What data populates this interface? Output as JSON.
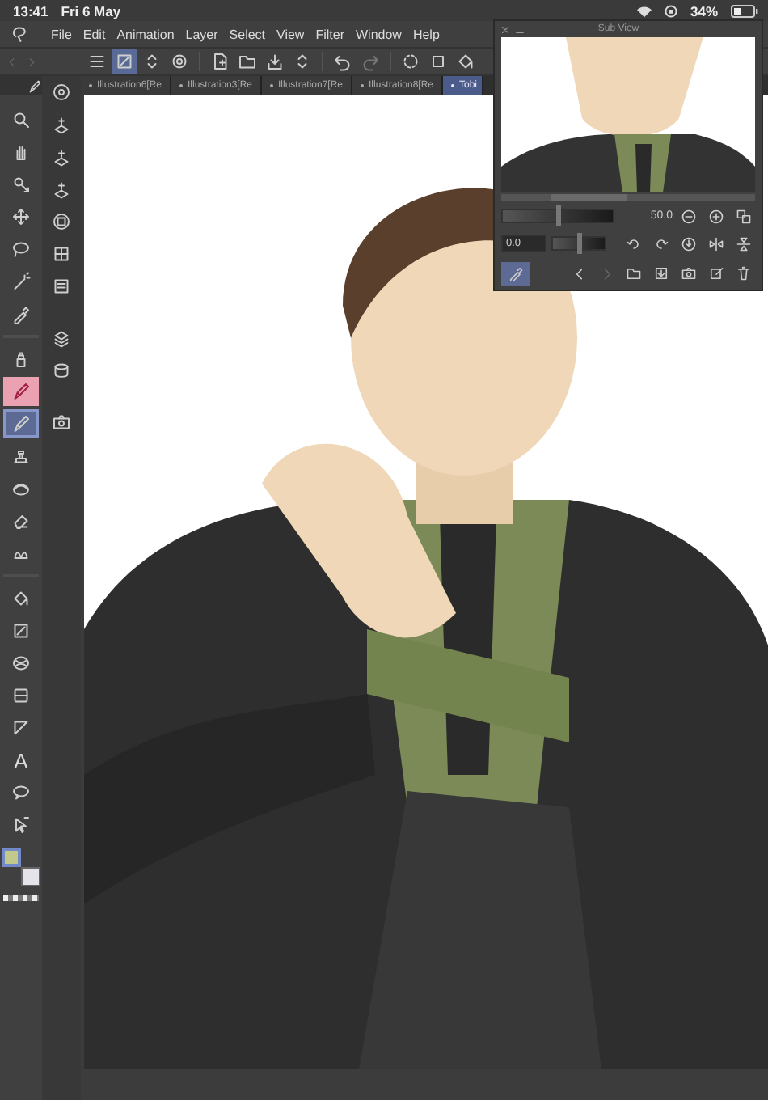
{
  "status_bar": {
    "time": "13:41",
    "date": "Fri 6 May",
    "battery": "34%"
  },
  "menu": [
    "File",
    "Edit",
    "Animation",
    "Layer",
    "Select",
    "View",
    "Filter",
    "Window",
    "Help"
  ],
  "toolbar": [
    {
      "selected": false
    },
    {
      "selected": true
    },
    {
      "selected": false
    },
    {
      "selected": false
    },
    {
      "selected": false
    },
    {
      "selected": false
    },
    {
      "selected": false
    },
    {
      "selected": false
    },
    {
      "selected": false
    },
    {
      "selected": false
    },
    {
      "selected": false
    },
    {
      "selected": false
    },
    {
      "selected": false
    }
  ],
  "document_tabs": [
    {
      "label": "Illustration6[Re",
      "selected": false
    },
    {
      "label": "Illustration3[Re",
      "selected": false
    },
    {
      "label": "Illustration7[Re",
      "selected": false
    },
    {
      "label": "Illustration8[Re",
      "selected": false
    },
    {
      "label": "Tobi",
      "selected": true
    }
  ],
  "tools": [
    {
      "selected": false
    },
    {
      "selected": false
    },
    {
      "selected": false
    },
    {
      "selected": false
    },
    {
      "selected": false
    },
    {
      "selected": false
    },
    {
      "selected": false
    },
    {
      "selected": false
    },
    {
      "selected": false,
      "color": "#eaa2b3"
    },
    {
      "selected": true
    },
    {
      "selected": false
    },
    {
      "selected": false
    },
    {
      "selected": false
    },
    {
      "selected": false
    },
    {
      "selected": false
    },
    {
      "selected": false
    },
    {
      "selected": false
    },
    {
      "selected": false
    },
    {
      "selected": false
    },
    {
      "kind": "text",
      "label": "A",
      "selected": false
    },
    {
      "selected": false
    },
    {
      "selected": false
    }
  ],
  "colors": [
    {
      "color": "#c3c98a",
      "selected": true
    },
    {
      "color": "#e4e4ea",
      "selected": false
    }
  ],
  "sub_view": {
    "title": "Sub View",
    "zoom": {
      "level": 0.5,
      "reading": "50.0"
    },
    "rotation": {
      "level": 0.5,
      "value": "0.0"
    },
    "eyedropper_selected": true
  }
}
